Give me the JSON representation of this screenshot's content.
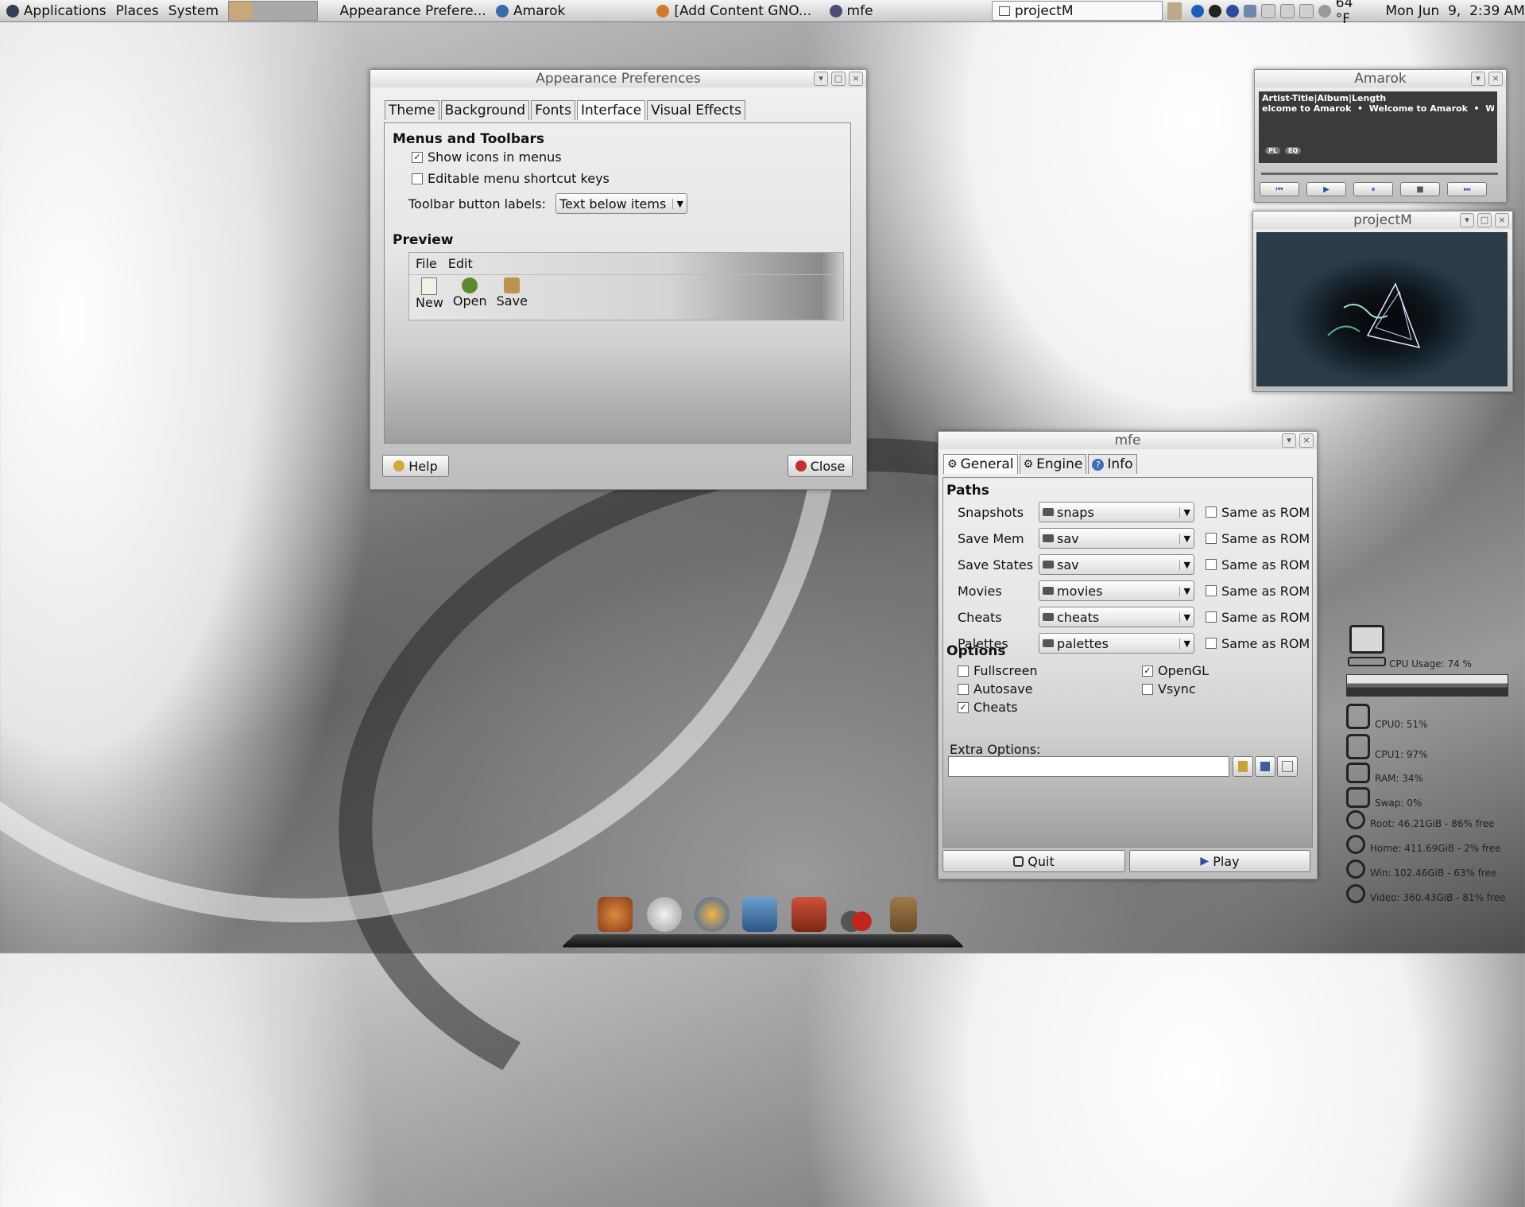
{
  "panel": {
    "menus": [
      "Applications",
      "Places",
      "System"
    ],
    "tasks": [
      "Appearance Prefere...",
      "Amarok",
      "[Add Content GNO...",
      "mfe",
      "projectM"
    ],
    "weather": "64 °F",
    "clock": "Mon Jun  9,  2:39 AM"
  },
  "appearance": {
    "title": "Appearance Preferences",
    "tabs": [
      "Theme",
      "Background",
      "Fonts",
      "Interface",
      "Visual Effects"
    ],
    "menus_heading": "Menus and Toolbars",
    "show_icons": "Show icons in menus",
    "editable_keys": "Editable menu shortcut keys",
    "toolbar_label": "Toolbar button labels:",
    "toolbar_value": "Text below items",
    "preview_heading": "Preview",
    "preview_menu": [
      "File",
      "Edit"
    ],
    "preview_buttons": [
      "New",
      "Open",
      "Save"
    ],
    "help": "Help",
    "close": "Close"
  },
  "amarok": {
    "title": "Amarok",
    "header": "Artist-Title|Album|Length",
    "scroll": "elcome to Amarok  •  Welcome to Amarok  •  W",
    "pl": "PL",
    "eq": "EQ"
  },
  "projectm": {
    "title": "projectM"
  },
  "mfe": {
    "title": "mfe",
    "tabs": [
      "General",
      "Engine",
      "Info"
    ],
    "paths_heading": "Paths",
    "paths": [
      {
        "label": "Snapshots",
        "value": "snaps"
      },
      {
        "label": "Save Mem",
        "value": "sav"
      },
      {
        "label": "Save States",
        "value": "sav"
      },
      {
        "label": "Movies",
        "value": "movies"
      },
      {
        "label": "Cheats",
        "value": "cheats"
      },
      {
        "label": "Palettes",
        "value": "palettes"
      }
    ],
    "same_as_rom": "Same as ROM",
    "options_heading": "Options",
    "options": {
      "fullscreen": "Fullscreen",
      "autosave": "Autosave",
      "cheats": "Cheats",
      "opengl": "OpenGL",
      "vsync": "Vsync"
    },
    "extra_label": "Extra Options:",
    "quit": "Quit",
    "play": "Play"
  },
  "monitor": {
    "cpu_usage": "CPU Usage: 74 %",
    "cpu0": "CPU0:  51%",
    "cpu1": "CPU1:  97%",
    "ram": "RAM:  34%",
    "swap": "Swap:  0%",
    "root": "Root:  46.21GiB - 86% free",
    "home": "Home:  411.69GiB - 2% free",
    "win": "Win:  102.46GiB - 63% free",
    "video": "Video:  360.43GiB - 81% free"
  }
}
